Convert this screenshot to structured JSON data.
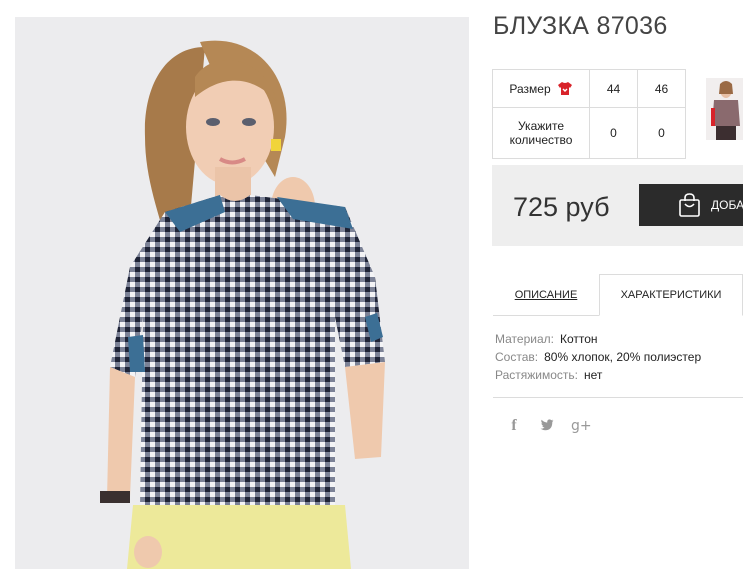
{
  "product": {
    "title": "БЛУЗКА 87036",
    "photo_icon": "model-photo",
    "thumbnail_icon": "model-thumbnail"
  },
  "size_table": {
    "size_label": "Размер",
    "size_icon": "shirt-icon",
    "sizes": [
      "44",
      "46"
    ],
    "qty_label_line1": "Укажите",
    "qty_label_line2": "количество",
    "quantities": [
      "0",
      "0"
    ]
  },
  "price": {
    "value": "725 руб",
    "cart_label": "ДОБАВИТЬ В КОРЗИНУ",
    "cart_icon": "shopping-bag-icon"
  },
  "tabs": {
    "description": "ОПИСАНИЕ",
    "characteristics": "ХАРАКТЕРИСТИКИ",
    "active": "characteristics"
  },
  "specs": [
    {
      "key": "Материал:",
      "value": "Коттон"
    },
    {
      "key": "Состав:",
      "value": "80% хлопок, 20% полиэстер"
    },
    {
      "key": "Растяжимость:",
      "value": "нет"
    }
  ],
  "social": {
    "facebook": "f",
    "twitter": "🐦",
    "google_plus": "g+"
  },
  "colors": {
    "button_bg": "#2b2b2b",
    "price_band_bg": "#eeeeee",
    "size_icon": "#d8232a",
    "border": "#dcdcdc"
  }
}
